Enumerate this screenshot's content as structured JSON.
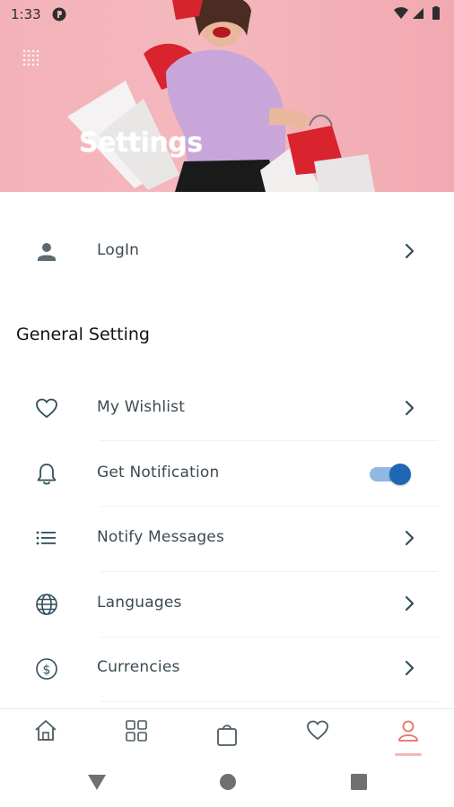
{
  "status_bar": {
    "time": "1:33"
  },
  "header": {
    "title": "Settings"
  },
  "login": {
    "label": "LogIn"
  },
  "general": {
    "title": "General Setting",
    "items": [
      {
        "label": "My Wishlist",
        "icon": "heart-icon"
      },
      {
        "label": "Get Notification",
        "icon": "bell-icon",
        "toggle_on": true
      },
      {
        "label": "Notify Messages",
        "icon": "list-icon"
      },
      {
        "label": "Languages",
        "icon": "globe-icon"
      },
      {
        "label": "Currencies",
        "icon": "dollar-icon"
      }
    ]
  },
  "tabs": [
    {
      "name": "home",
      "icon": "home-icon"
    },
    {
      "name": "categories",
      "icon": "grid-icon"
    },
    {
      "name": "cart",
      "icon": "bag-icon"
    },
    {
      "name": "wishlist",
      "icon": "heart-icon"
    },
    {
      "name": "account",
      "icon": "user-icon",
      "active": true
    }
  ],
  "colors": {
    "accent_active_tab": "#e8735f",
    "toggle_knob": "#1f66b3",
    "toggle_track": "#8fb8e3",
    "hero_background": "#f3b2b8",
    "icon_color": "#2f4f5a"
  }
}
